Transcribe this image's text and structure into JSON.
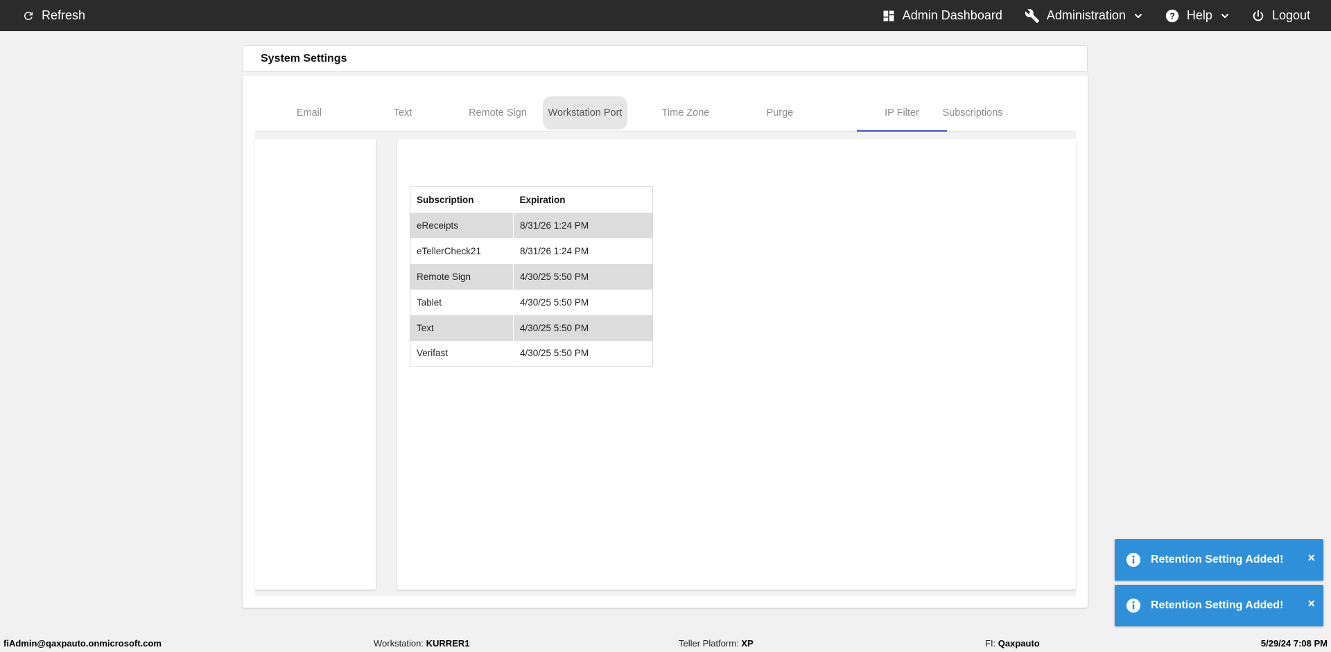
{
  "topbar": {
    "refresh_label": "Refresh",
    "admin_dashboard_label": "Admin Dashboard",
    "administration_label": "Administration",
    "help_label": "Help",
    "logout_label": "Logout"
  },
  "page": {
    "title": "System Settings"
  },
  "tabs": [
    {
      "label": "Email"
    },
    {
      "label": "Text"
    },
    {
      "label": "Remote Sign"
    },
    {
      "label": "Workstation Port"
    },
    {
      "label": "Time Zone"
    },
    {
      "label": "Purge"
    },
    {
      "label": "IP Filter"
    },
    {
      "label": "Subscriptions"
    }
  ],
  "subscriptions_table": {
    "headers": [
      "Subscription",
      "Expiration"
    ],
    "rows": [
      [
        "eReceipts",
        "8/31/26 1:24 PM"
      ],
      [
        "eTellerCheck21",
        "8/31/26 1:24 PM"
      ],
      [
        "Remote Sign",
        "4/30/25 5:50 PM"
      ],
      [
        "Tablet",
        "4/30/25 5:50 PM"
      ],
      [
        "Text",
        "4/30/25 5:50 PM"
      ],
      [
        "Verifast",
        "4/30/25 5:50 PM"
      ]
    ]
  },
  "toasts": [
    {
      "message": "Retention Setting Added!",
      "close": "×"
    },
    {
      "message": "Retention Setting Added!",
      "close": "×"
    }
  ],
  "statusbar": {
    "user": "fiAdmin@qaxpauto.onmicrosoft.com",
    "workstation_label": "Workstation:",
    "workstation_value": "KURRER1",
    "platform_label": "Teller Platform:",
    "platform_value": "XP",
    "fi_label": "FI:",
    "fi_value": "Qaxpauto",
    "datetime": "5/29/24 7:08 PM"
  },
  "colors": {
    "topbar": "#2b2b2b",
    "accent": "#3f51b5",
    "toast": "#2f8fd8"
  }
}
